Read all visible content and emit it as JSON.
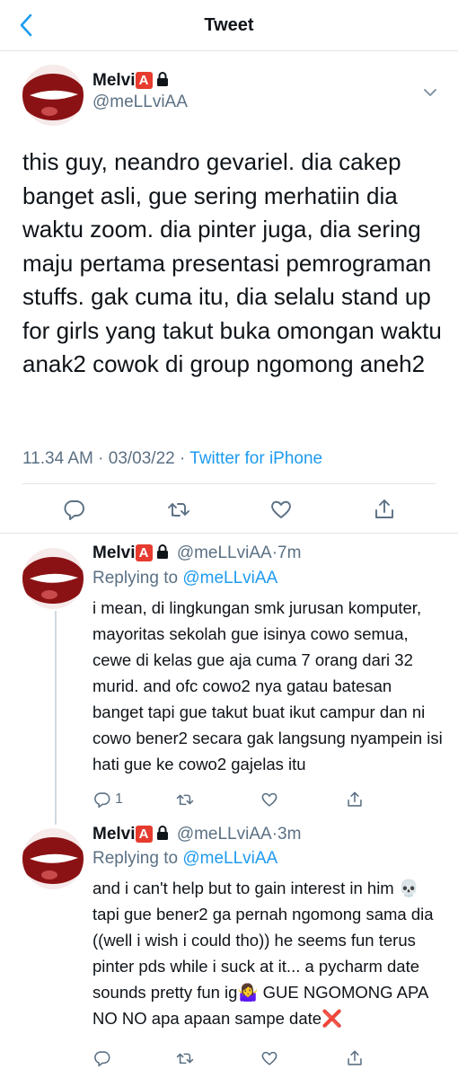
{
  "header": {
    "title": "Tweet"
  },
  "main": {
    "name": "Melvi",
    "badge": "A",
    "handle": "@meLLviAA",
    "text": "this guy, neandro gevariel. dia cakep banget asli, gue sering merhatiin dia waktu zoom. dia pinter juga, dia sering maju pertama presentasi pemrograman stuffs. gak cuma itu, dia selalu stand up for girls yang takut buka omongan waktu anak2 cowok di group ngomong aneh2",
    "time": "11.34 AM",
    "date": "03/03/22",
    "sep": "·",
    "source": "Twitter for iPhone"
  },
  "replies": [
    {
      "name": "Melvi",
      "badge": "A",
      "handle": "@meLLviAA",
      "age": "7m",
      "replying_prefix": "Replying to",
      "replying_handle": "@meLLviAA",
      "text": "i mean, di lingkungan smk jurusan komputer, mayoritas sekolah gue isinya cowo semua, cewe di kelas gue aja cuma 7 orang dari 32 murid. and ofc cowo2 nya gatau batesan banget tapi gue takut buat ikut campur dan ni cowo bener2 secara gak langsung nyampein isi hati gue ke cowo2 gajelas itu",
      "reply_count": "1"
    },
    {
      "name": "Melvi",
      "badge": "A",
      "handle": "@meLLviAA",
      "age": "3m",
      "replying_prefix": "Replying to",
      "replying_handle": "@meLLviAA",
      "text": "and i can't help but to gain interest in him 💀 tapi gue bener2 ga pernah ngomong sama dia ((well i wish i could tho)) he seems fun terus pinter pds while i suck at it... a pycharm date sounds pretty fun ig🤷‍♀️ GUE NGOMONG APA NO NO apa apaan sampe date❌",
      "reply_count": ""
    }
  ],
  "icons": [
    "back-chevron-icon",
    "lock-icon",
    "chevron-down-icon",
    "reply-icon",
    "retweet-icon",
    "like-icon",
    "share-icon"
  ],
  "colors": {
    "accent": "#1d9bf0",
    "muted": "#5b7083",
    "badge": "#e63b2e",
    "avatar": "#8b1214"
  }
}
